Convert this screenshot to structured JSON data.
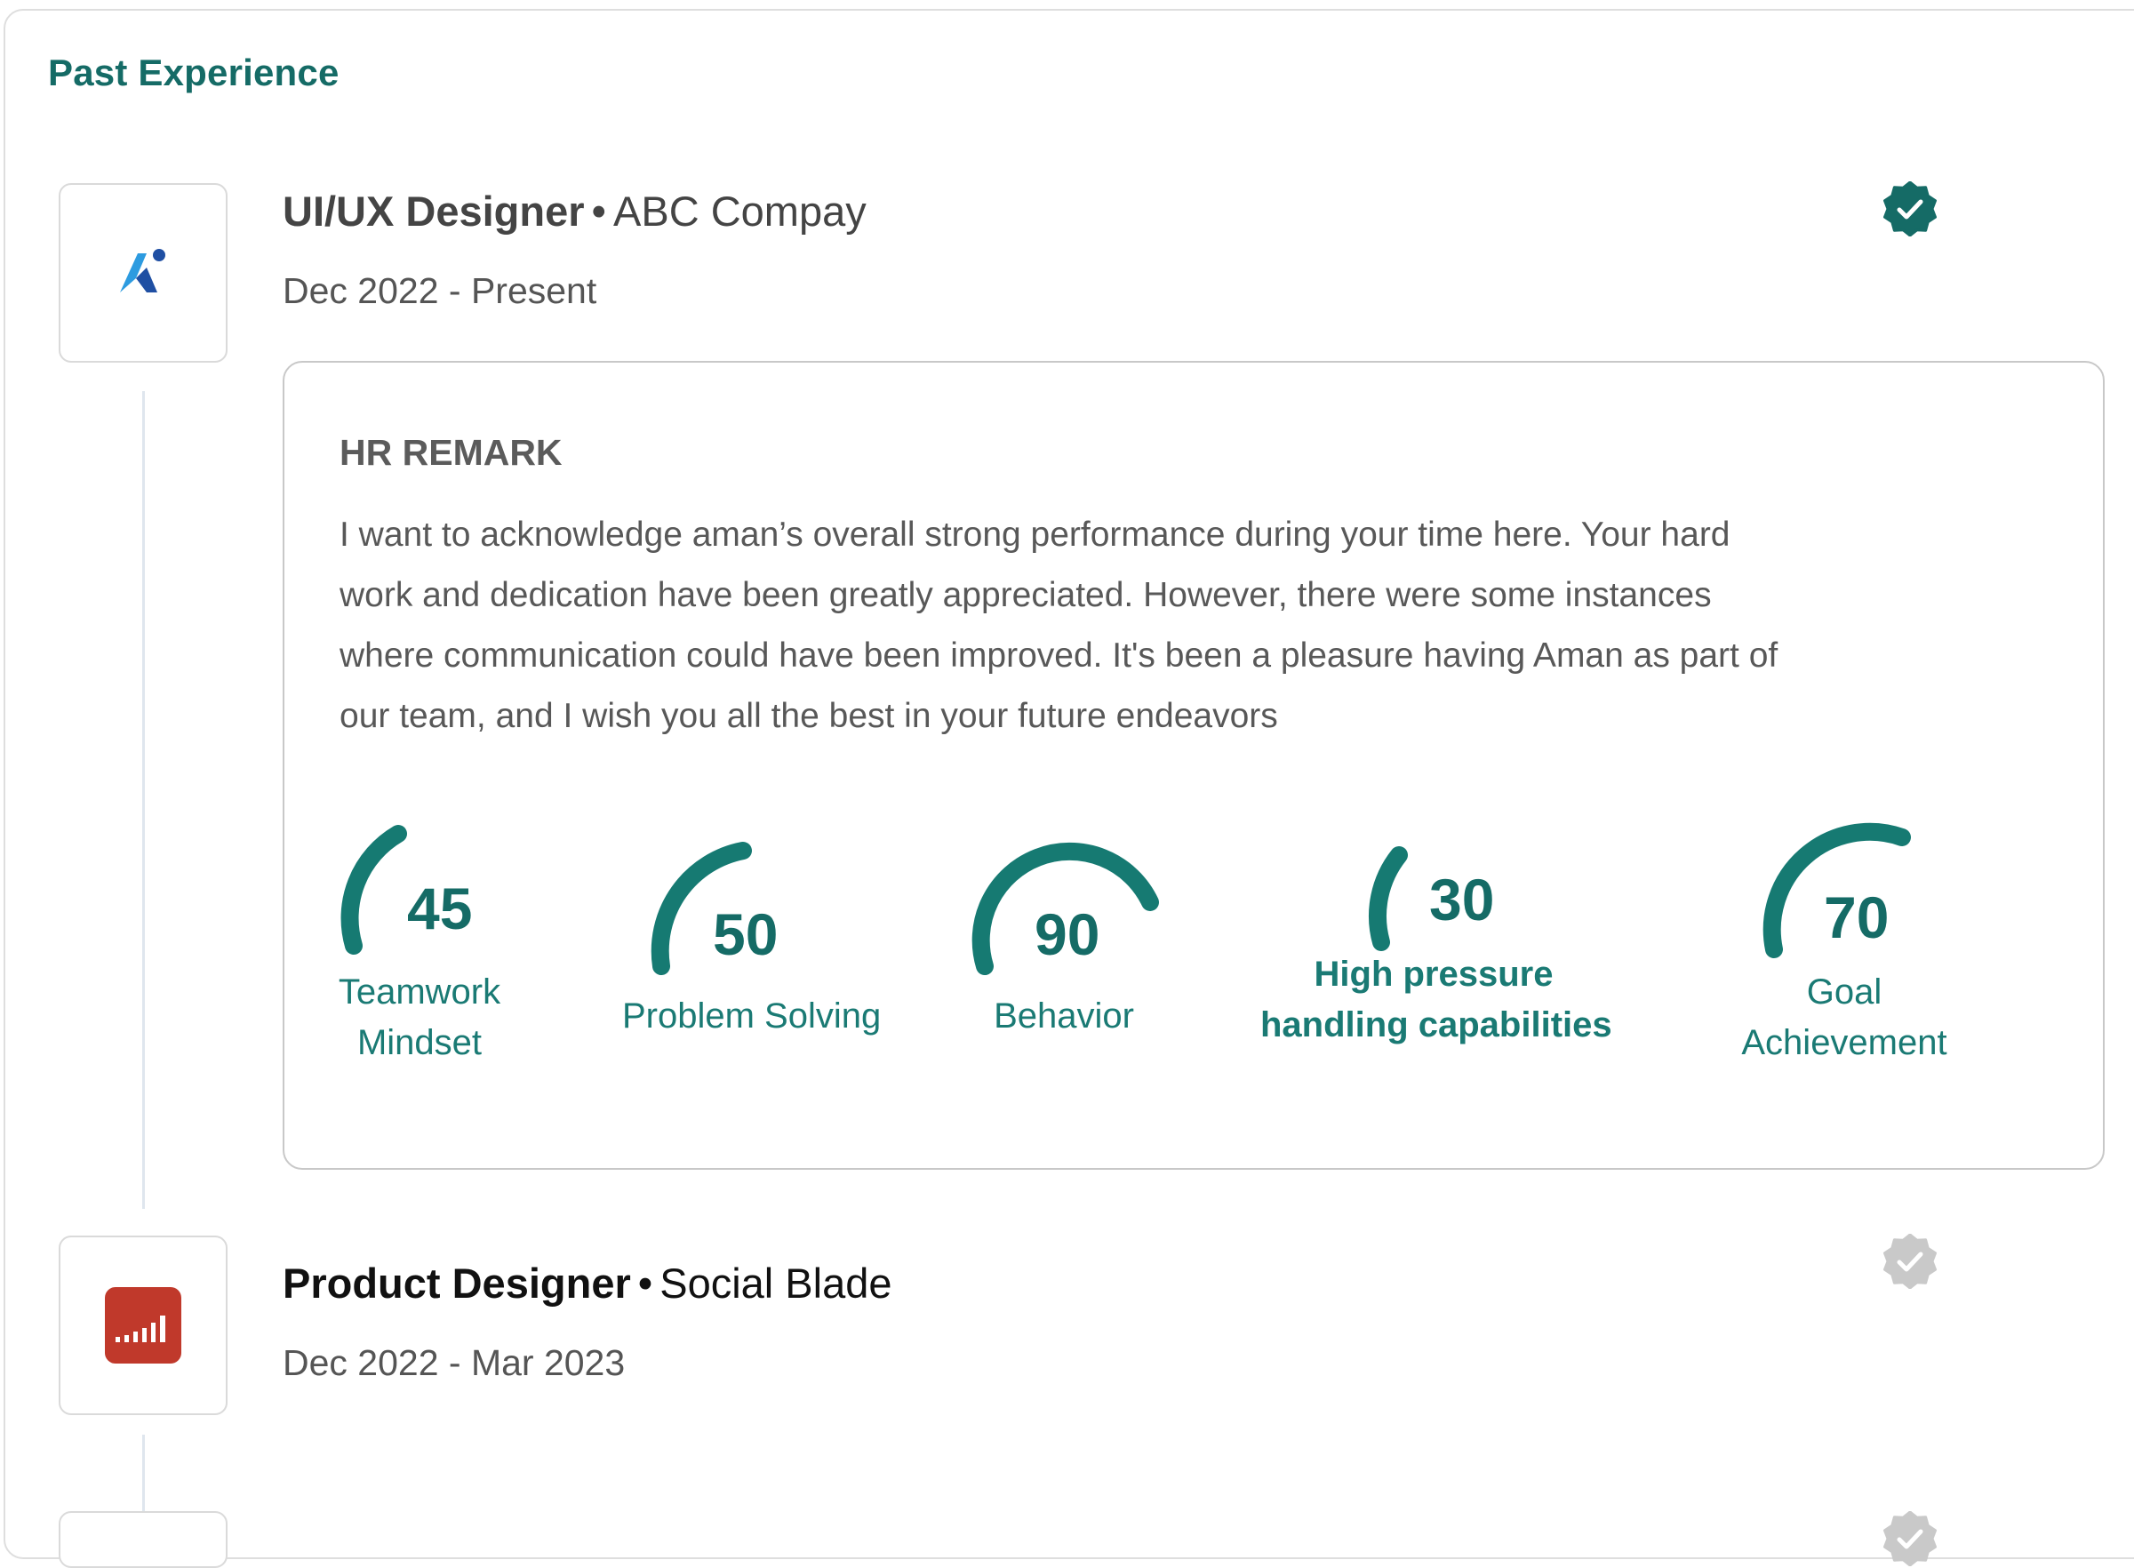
{
  "section": {
    "title": "Past Experience"
  },
  "colors": {
    "accent": "#156b66",
    "track": "#167a72",
    "badge_verified": "#156b66",
    "badge_unverified": "#c9c9c9"
  },
  "experiences": [
    {
      "role": "UI/UX Designer",
      "separator": "•",
      "company": "ABC Compay",
      "dates": "Dec 2022 - Present",
      "logo_icon": "abc-company-logo-icon",
      "verified": true,
      "hr_remark": {
        "heading": "HR REMARK",
        "lines": [
          "I want to acknowledge aman’s overall strong performance during your time here. Your hard",
          "work and dedication have been greatly appreciated. However, there were some instances",
          "where communication could have been improved. It's been a pleasure having Aman as part of",
          "our team, and I wish you all the best in your future endeavors"
        ],
        "metrics": [
          {
            "value": "45",
            "label_lines": [
              "Teamwork",
              "Mindset"
            ]
          },
          {
            "value": "50",
            "label_lines": [
              "Problem Solving"
            ]
          },
          {
            "value": "90",
            "label_lines": [
              "Behavior"
            ]
          },
          {
            "value": "30",
            "label_lines": [
              "High pressure",
              "handling capabilities"
            ]
          },
          {
            "value": "70",
            "label_lines": [
              "Goal",
              "Achievement"
            ]
          }
        ]
      }
    },
    {
      "role": "Product Designer",
      "separator": "•",
      "company": "Social Blade",
      "dates": "Dec 2022 - Mar 2023",
      "logo_icon": "social-blade-logo-icon",
      "verified": false
    }
  ]
}
